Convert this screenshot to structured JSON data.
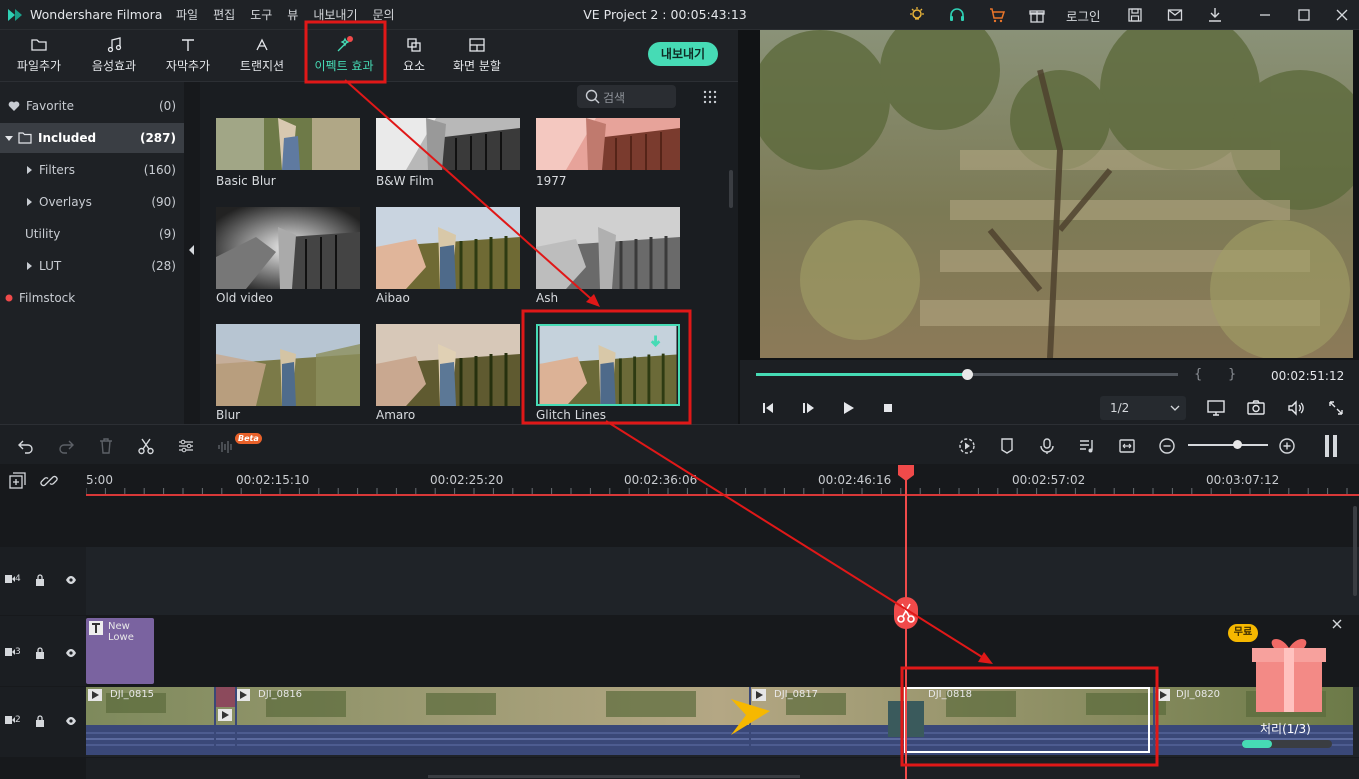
{
  "titlebar": {
    "app_name": "Wondershare Filmora",
    "menu": [
      "파일",
      "편집",
      "도구",
      "뷰",
      "내보내기",
      "문의"
    ],
    "project_title": "VE Project 2 : 00:05:43:13",
    "login_label": "로그인"
  },
  "media_tabs": [
    {
      "label": "파일추가",
      "icon": "folder-icon"
    },
    {
      "label": "음성효과",
      "icon": "music-note-icon"
    },
    {
      "label": "자막추가",
      "icon": "text-icon"
    },
    {
      "label": "트랜지션",
      "icon": "transition-icon"
    },
    {
      "label": "이펙트 효과",
      "icon": "effects-icon",
      "active": true
    },
    {
      "label": "요소",
      "icon": "elements-icon"
    },
    {
      "label": "화면 분할",
      "icon": "split-screen-icon"
    }
  ],
  "export_label": "내보내기",
  "sidebar": {
    "items": [
      {
        "label": "Favorite",
        "count": "(0)"
      },
      {
        "label": "Included",
        "count": "(287)"
      },
      {
        "label": "Filters",
        "count": "(160)"
      },
      {
        "label": "Overlays",
        "count": "(90)"
      },
      {
        "label": "Utility",
        "count": "(9)"
      },
      {
        "label": "LUT",
        "count": "(28)"
      },
      {
        "label": "Filmstock",
        "count": ""
      }
    ]
  },
  "search": {
    "placeholder": "검색"
  },
  "effects": [
    {
      "label": "Basic Blur"
    },
    {
      "label": "B&W Film"
    },
    {
      "label": "1977"
    },
    {
      "label": "Old video"
    },
    {
      "label": "Aibao"
    },
    {
      "label": "Ash"
    },
    {
      "label": "Blur"
    },
    {
      "label": "Amaro"
    },
    {
      "label": "Glitch Lines"
    }
  ],
  "preview": {
    "timecode": "00:02:51:12",
    "quality": "1/2",
    "progress": 0.5,
    "bracket_left": "{",
    "bracket_right": "}"
  },
  "timeline": {
    "beta_label": "Beta",
    "ruler": [
      "5:00",
      "00:02:15:10",
      "00:02:25:20",
      "00:02:36:06",
      "00:02:46:16",
      "00:02:57:02",
      "00:03:07:12"
    ],
    "tracks": [
      {
        "number": "4"
      },
      {
        "number": "3"
      },
      {
        "number": "2"
      }
    ],
    "title_clip": "New Lowe",
    "clips": [
      "DJI_0815",
      "DJI_0816",
      "DJI_0817",
      "DJI_0818",
      "DJI_0820"
    ]
  },
  "gift": {
    "badge": "무료",
    "caption": "처리(1/3)"
  }
}
